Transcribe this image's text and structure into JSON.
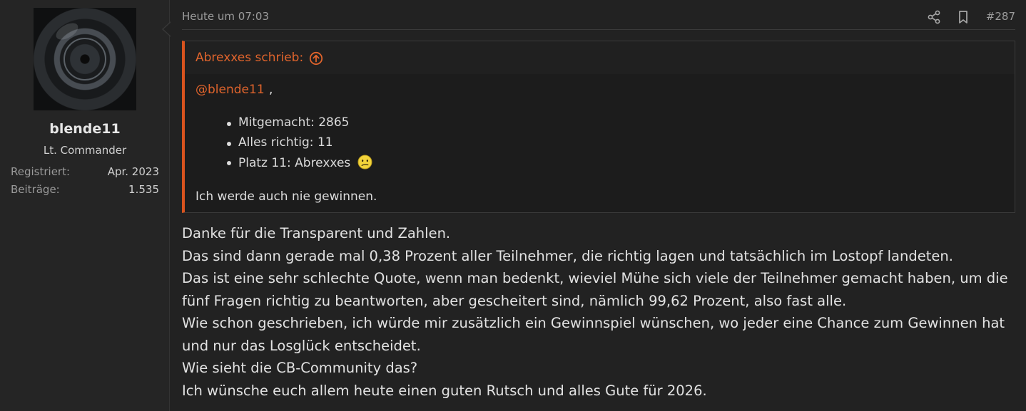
{
  "user": {
    "name": "blende11",
    "title": "Lt. Commander",
    "stats": [
      {
        "label": "Registriert:",
        "value": "Apr. 2023"
      },
      {
        "label": "Beiträge:",
        "value": "1.535"
      }
    ],
    "avatar": "camera-aperture-avatar"
  },
  "post": {
    "date": "Heute um 07:03",
    "number": "#287",
    "icons": [
      "share-icon",
      "bookmark-icon"
    ],
    "quote": {
      "author_label": "Abrexxes schrieb:",
      "mention": "@blende11",
      "mention_suffix": ",",
      "items": [
        {
          "text": "Mitgemacht: 2865"
        },
        {
          "text": "Alles richtig: 11"
        },
        {
          "text": "Platz 11: Abrexxes",
          "emoji": "confused-smiley-icon"
        }
      ],
      "closing": "Ich werde auch nie gewinnen."
    },
    "body_lines": [
      "Danke für die Transparent und Zahlen.",
      "Das sind dann gerade mal 0,38 Prozent aller Teilnehmer, die richtig lagen und tatsächlich im Lostopf landeten.",
      "Das ist eine sehr schlechte Quote, wenn man bedenkt, wieviel Mühe sich viele der Teilnehmer gemacht haben, um die",
      "fünf Fragen richtig zu beantworten, aber gescheitert sind, nämlich 99,62 Prozent, also fast alle.",
      "Wie schon geschrieben, ich würde mir zusätzlich ein Gewinnspiel wünschen, wo jeder eine Chance zum Gewinnen hat",
      "und nur das Losglück entscheidet.",
      "Wie sieht die CB-Community das?",
      "Ich wünsche euch allem heute einen guten Rutsch und alles Gute für 2026."
    ]
  },
  "colors": {
    "accent": "#e0642c",
    "quote_border": "#d9531e",
    "background": "#222222"
  }
}
